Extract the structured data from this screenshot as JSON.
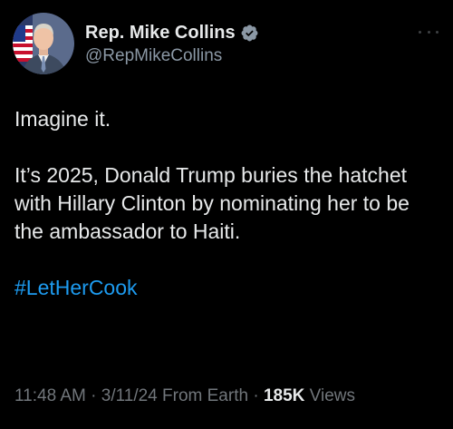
{
  "author": {
    "display_name": "Rep. Mike Collins",
    "handle": "@RepMikeCollins",
    "verified": true,
    "verified_color": "#8b98a5"
  },
  "tweet": {
    "lines": [
      "Imagine it.",
      "",
      "It’s 2025, Donald Trump buries the hatchet with Hillary Clinton by nominating her to be the ambassador to Haiti."
    ],
    "intro": "Imagine it.",
    "body": "It’s 2025, Donald Trump buries the hatchet with Hillary Clinton by nominating her to be the ambassador to Haiti.",
    "hashtag": "#LetHerCook"
  },
  "meta": {
    "time": "11:48 AM",
    "separator": "·",
    "date": "3/11/24",
    "source": "From Earth",
    "views_count": "185K",
    "views_label": "Views"
  },
  "icons": {
    "more": "more-horizontal-icon",
    "verified": "verified-badge-icon"
  },
  "colors": {
    "background": "#000000",
    "text": "#e7e9ea",
    "secondary": "#71767b",
    "link": "#1d9bf0"
  }
}
